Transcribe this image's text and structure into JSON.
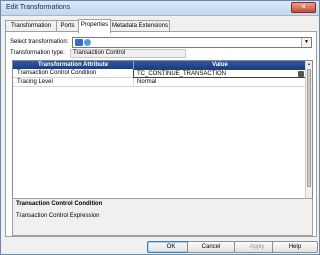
{
  "window": {
    "title": "Edit Transformations",
    "close_glyph": "✕"
  },
  "tabs": [
    {
      "label": "Transformation"
    },
    {
      "label": "Ports"
    },
    {
      "label": "Properties"
    },
    {
      "label": "Metadata Extensions"
    }
  ],
  "active_tab": "Properties",
  "select_transformation": {
    "label": "Select transformation:",
    "icon": "transformation-icon"
  },
  "transformation_type": {
    "label": "Transformation type:",
    "value": "Transaction Control"
  },
  "grid": {
    "headers": [
      "Transformation Attribute",
      "Value"
    ],
    "rows": [
      {
        "attribute": "Transaction Control Condition",
        "value": "TC_CONTINUE_TRANSACTION"
      },
      {
        "attribute": "Tracing Level",
        "value": "Normal"
      }
    ]
  },
  "description": {
    "title": "Transaction Control Condition",
    "text": "Transaction Control Expression"
  },
  "buttons": {
    "ok": "OK",
    "cancel": "Cancel",
    "apply": "Apply",
    "help": "Help"
  },
  "colors": {
    "grid_header": "#1e4a96",
    "ok_border": "#3c7fb1"
  }
}
